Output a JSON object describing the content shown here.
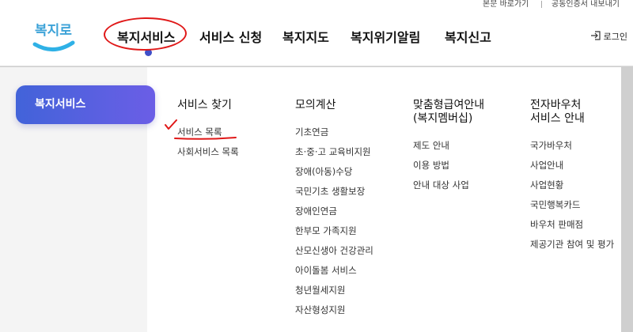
{
  "utility": {
    "skip_link": "본문 바로가기",
    "cert_link": "공동인증서 내보내기"
  },
  "header": {
    "logo_text": "복지로",
    "nav": [
      "복지서비스",
      "서비스 신청",
      "복지지도",
      "복지위기알림",
      "복지신고"
    ],
    "login": "로그인"
  },
  "sidebar": {
    "active_label": "복지서비스"
  },
  "menu": {
    "columns": [
      {
        "title": [
          "서비스 찾기"
        ],
        "items": [
          "서비스 목록",
          "사회서비스 목록"
        ]
      },
      {
        "title": [
          "모의계산"
        ],
        "items": [
          "기초연금",
          "초·중·고 교육비지원",
          "장애(아동)수당",
          "국민기초 생활보장",
          "장애인연금",
          "한부모 가족지원",
          "산모신생아 건강관리",
          "아이돌봄 서비스",
          "청년월세지원",
          "자산형성지원"
        ]
      },
      {
        "title": [
          "맞춤형급여안내",
          "(복지멤버십)"
        ],
        "items": [
          "제도 안내",
          "이용 방법",
          "안내 대상 사업"
        ]
      },
      {
        "title": [
          "전자바우처",
          "서비스 안내"
        ],
        "items": [
          "국가바우처",
          "사업안내",
          "사업현황",
          "국민행복카드",
          "바우처 판매점",
          "제공기관 참여 및 평가"
        ]
      }
    ]
  },
  "colors": {
    "accent": "#4263d9",
    "annotation": "#e01818"
  }
}
